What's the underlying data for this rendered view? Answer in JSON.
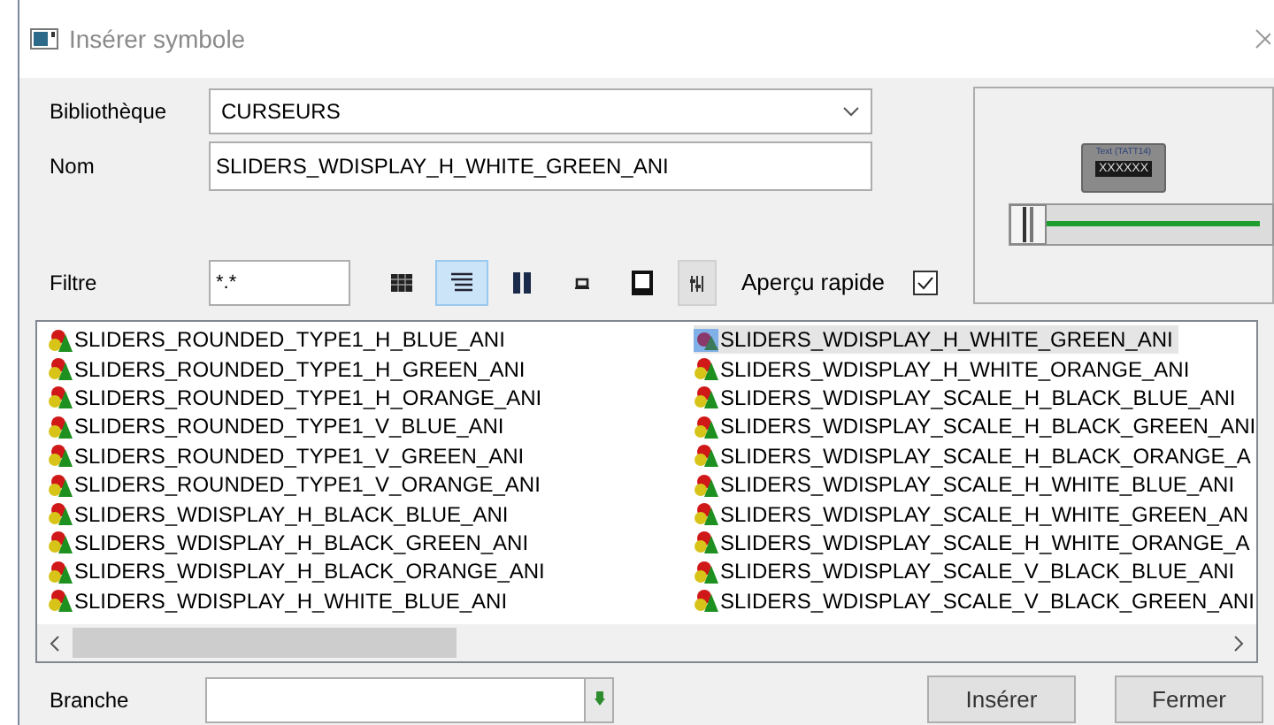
{
  "window": {
    "title": "Insérer symbole"
  },
  "library": {
    "label": "Bibliothèque",
    "value": "CURSEURS"
  },
  "name_field": {
    "label": "Nom",
    "value": "SLIDERS_WDISPLAY_H_WHITE_GREEN_ANI"
  },
  "filter": {
    "label": "Filtre",
    "value": "*.*"
  },
  "view_modes": [
    {
      "kind": "grid",
      "selected": false
    },
    {
      "kind": "details",
      "selected": true
    },
    {
      "kind": "columns",
      "selected": false
    },
    {
      "kind": "small",
      "selected": false
    },
    {
      "kind": "large",
      "selected": false
    }
  ],
  "quick_preview": {
    "label": "Aperçu rapide",
    "checked": true
  },
  "preview": {
    "caption": "Text (TATT14)",
    "display": "XXXXXX"
  },
  "symbols": [
    {
      "label": "SLIDERS_ROUNDED_TYPE1_H_BLUE_ANI",
      "selected": false
    },
    {
      "label": "SLIDERS_ROUNDED_TYPE1_H_GREEN_ANI",
      "selected": false
    },
    {
      "label": "SLIDERS_ROUNDED_TYPE1_H_ORANGE_ANI",
      "selected": false
    },
    {
      "label": "SLIDERS_ROUNDED_TYPE1_V_BLUE_ANI",
      "selected": false
    },
    {
      "label": "SLIDERS_ROUNDED_TYPE1_V_GREEN_ANI",
      "selected": false
    },
    {
      "label": "SLIDERS_ROUNDED_TYPE1_V_ORANGE_ANI",
      "selected": false
    },
    {
      "label": "SLIDERS_WDISPLAY_H_BLACK_BLUE_ANI",
      "selected": false
    },
    {
      "label": "SLIDERS_WDISPLAY_H_BLACK_GREEN_ANI",
      "selected": false
    },
    {
      "label": "SLIDERS_WDISPLAY_H_BLACK_ORANGE_ANI",
      "selected": false
    },
    {
      "label": "SLIDERS_WDISPLAY_H_WHITE_BLUE_ANI",
      "selected": false
    },
    {
      "label": "SLIDERS_WDISPLAY_H_WHITE_GREEN_ANI",
      "selected": true
    },
    {
      "label": "SLIDERS_WDISPLAY_H_WHITE_ORANGE_ANI",
      "selected": false
    },
    {
      "label": "SLIDERS_WDISPLAY_SCALE_H_BLACK_BLUE_ANI",
      "selected": false
    },
    {
      "label": "SLIDERS_WDISPLAY_SCALE_H_BLACK_GREEN_ANI",
      "selected": false
    },
    {
      "label": "SLIDERS_WDISPLAY_SCALE_H_BLACK_ORANGE_A",
      "selected": false
    },
    {
      "label": "SLIDERS_WDISPLAY_SCALE_H_WHITE_BLUE_ANI",
      "selected": false
    },
    {
      "label": "SLIDERS_WDISPLAY_SCALE_H_WHITE_GREEN_AN",
      "selected": false
    },
    {
      "label": "SLIDERS_WDISPLAY_SCALE_H_WHITE_ORANGE_A",
      "selected": false
    },
    {
      "label": "SLIDERS_WDISPLAY_SCALE_V_BLACK_BLUE_ANI",
      "selected": false
    },
    {
      "label": "SLIDERS_WDISPLAY_SCALE_V_BLACK_GREEN_ANI",
      "selected": false
    }
  ],
  "branch": {
    "label": "Branche"
  },
  "buttons": [
    "Insérer",
    "Fermer"
  ]
}
